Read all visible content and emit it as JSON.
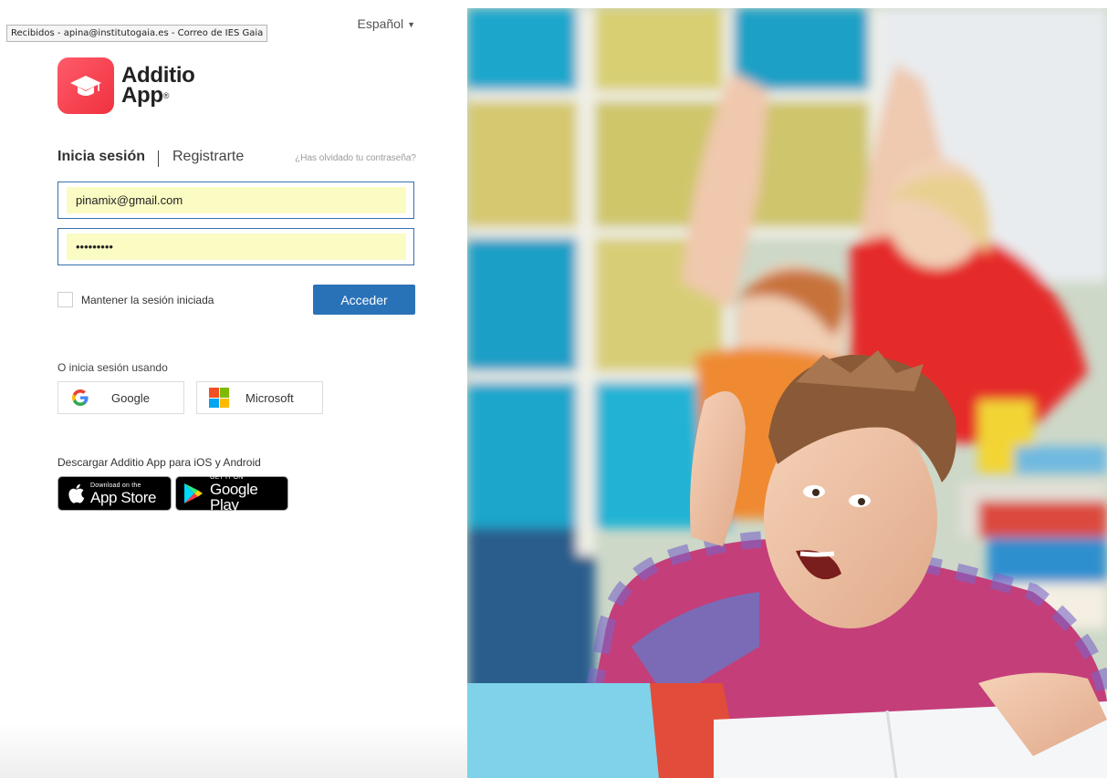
{
  "tooltip": {
    "text": "Recibidos - apina@institutogaia.es - Correo de IES Gaia"
  },
  "language": {
    "selected": "Español"
  },
  "brand": {
    "name_line1": "Additio",
    "name_line2": "App",
    "registered": "®",
    "color": "#f23d4a"
  },
  "auth_tabs": {
    "login": "Inicia sesión",
    "register": "Registrarte",
    "forgot": "¿Has olvidado tu contraseña?"
  },
  "form": {
    "email_value": "pinamix@gmail.com",
    "password_value": "•••••••••",
    "remember_label": "Mantener la sesión iniciada",
    "submit_label": "Acceder",
    "autofill_color": "#fbfbc4",
    "accent": "#2a72b8"
  },
  "social": {
    "heading": "O inicia sesión usando",
    "google_label": "Google",
    "microsoft_label": "Microsoft"
  },
  "download": {
    "heading": "Descargar Additio App para iOS y Android",
    "appstore_small": "Download on the",
    "appstore_big": "App Store",
    "googleplay_small": "GET IT ON",
    "googleplay_big": "Google Play"
  },
  "icons": [
    "graduation-cap-icon",
    "caret-down-icon",
    "google-icon",
    "microsoft-icon",
    "apple-icon",
    "google-play-icon"
  ]
}
